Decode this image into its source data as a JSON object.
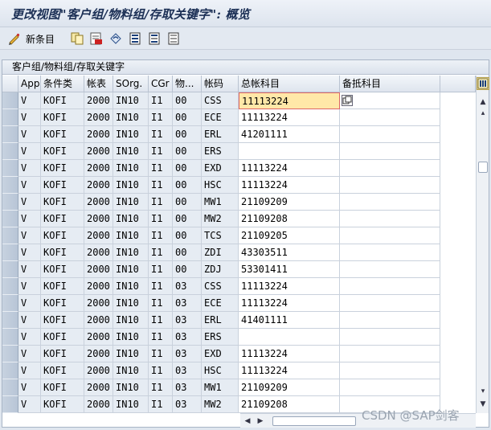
{
  "window": {
    "title": "更改视图\"客户组/物料组/存取关键字\": 概览"
  },
  "toolbar": {
    "new_entries_label": "新条目"
  },
  "panel": {
    "title": "客户组/物料组/存取关键字"
  },
  "table": {
    "columns": [
      "App",
      "条件类",
      "帐表",
      "SOrg.",
      "CGr",
      "物...",
      "帐码",
      "总帐科目",
      "备抵科目"
    ],
    "rows": [
      [
        "V",
        "KOFI",
        "2000",
        "IN10",
        "I1",
        "00",
        "CSS",
        "11113224",
        ""
      ],
      [
        "V",
        "KOFI",
        "2000",
        "IN10",
        "I1",
        "00",
        "ECE",
        "11113224",
        ""
      ],
      [
        "V",
        "KOFI",
        "2000",
        "IN10",
        "I1",
        "00",
        "ERL",
        "41201111",
        ""
      ],
      [
        "V",
        "KOFI",
        "2000",
        "IN10",
        "I1",
        "00",
        "ERS",
        "",
        ""
      ],
      [
        "V",
        "KOFI",
        "2000",
        "IN10",
        "I1",
        "00",
        "EXD",
        "11113224",
        ""
      ],
      [
        "V",
        "KOFI",
        "2000",
        "IN10",
        "I1",
        "00",
        "HSC",
        "11113224",
        ""
      ],
      [
        "V",
        "KOFI",
        "2000",
        "IN10",
        "I1",
        "00",
        "MW1",
        "21109209",
        ""
      ],
      [
        "V",
        "KOFI",
        "2000",
        "IN10",
        "I1",
        "00",
        "MW2",
        "21109208",
        ""
      ],
      [
        "V",
        "KOFI",
        "2000",
        "IN10",
        "I1",
        "00",
        "TCS",
        "21109205",
        ""
      ],
      [
        "V",
        "KOFI",
        "2000",
        "IN10",
        "I1",
        "00",
        "ZDI",
        "43303511",
        ""
      ],
      [
        "V",
        "KOFI",
        "2000",
        "IN10",
        "I1",
        "00",
        "ZDJ",
        "53301411",
        ""
      ],
      [
        "V",
        "KOFI",
        "2000",
        "IN10",
        "I1",
        "03",
        "CSS",
        "11113224",
        ""
      ],
      [
        "V",
        "KOFI",
        "2000",
        "IN10",
        "I1",
        "03",
        "ECE",
        "11113224",
        ""
      ],
      [
        "V",
        "KOFI",
        "2000",
        "IN10",
        "I1",
        "03",
        "ERL",
        "41401111",
        ""
      ],
      [
        "V",
        "KOFI",
        "2000",
        "IN10",
        "I1",
        "03",
        "ERS",
        "",
        ""
      ],
      [
        "V",
        "KOFI",
        "2000",
        "IN10",
        "I1",
        "03",
        "EXD",
        "11113224",
        ""
      ],
      [
        "V",
        "KOFI",
        "2000",
        "IN10",
        "I1",
        "03",
        "HSC",
        "11113224",
        ""
      ],
      [
        "V",
        "KOFI",
        "2000",
        "IN10",
        "I1",
        "03",
        "MW1",
        "21109209",
        ""
      ],
      [
        "V",
        "KOFI",
        "2000",
        "IN10",
        "I1",
        "03",
        "MW2",
        "21109208",
        ""
      ]
    ]
  },
  "watermark": "CSDN @SAP剑客"
}
